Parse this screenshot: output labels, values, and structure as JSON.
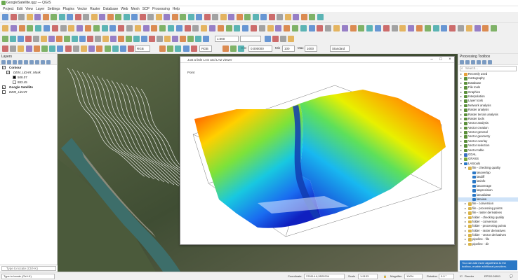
{
  "window": {
    "title": "GoogleSatellite.qgz — QGIS"
  },
  "menu": [
    "Project",
    "Edit",
    "View",
    "Layer",
    "Settings",
    "Plugins",
    "Vector",
    "Raster",
    "Database",
    "Web",
    "Mesh",
    "SCP",
    "Processing",
    "Help"
  ],
  "toolbar": {
    "scale_combo": "1:000",
    "rgb_combo": "RGB",
    "band_combo": "RGB",
    "dist_label": "Dist",
    "dist_value": "0.000000",
    "min_label": "Min",
    "min_value": "100",
    "max_label": "Max",
    "max_value": "1000",
    "standard_combo": "Standard"
  },
  "layers_panel": {
    "title": "Layers",
    "items": [
      {
        "label": "Contour",
        "checked": true,
        "bold": true,
        "indent": 0
      },
      {
        "label": "DEM_LiDAR_Mask",
        "checked": true,
        "bold": false,
        "indent": 1
      },
      {
        "label": "508.07",
        "swatch": "#000000",
        "indent": 2
      },
      {
        "label": "883.45",
        "swatch": "#ffffff",
        "indent": 2
      },
      {
        "label": "Google Satellite",
        "checked": true,
        "bold": true,
        "indent": 0
      },
      {
        "label": "DEM_LiDAR",
        "checked": false,
        "bold": false,
        "indent": 0
      }
    ],
    "search_placeholder": "Type to locate (Ctrl+K)"
  },
  "viewer": {
    "title": "Just a little LAS and LAZ viewer",
    "label": "Point"
  },
  "toolbox": {
    "title": "Processing Toolbox",
    "search_placeholder": "Search...",
    "items": [
      {
        "label": "Recently used",
        "level": 0,
        "arrow": "▸",
        "icon": "#e8a03a"
      },
      {
        "label": "Cartography",
        "level": 0,
        "arrow": "▸",
        "icon": "#5a8f3a"
      },
      {
        "label": "Database",
        "level": 0,
        "arrow": "▸",
        "icon": "#5a8f3a"
      },
      {
        "label": "File tools",
        "level": 0,
        "arrow": "▸",
        "icon": "#5a8f3a"
      },
      {
        "label": "Graphics",
        "level": 0,
        "arrow": "▸",
        "icon": "#5a8f3a"
      },
      {
        "label": "Interpolation",
        "level": 0,
        "arrow": "▸",
        "icon": "#5a8f3a"
      },
      {
        "label": "Layer tools",
        "level": 0,
        "arrow": "▸",
        "icon": "#5a8f3a"
      },
      {
        "label": "Network analysis",
        "level": 0,
        "arrow": "▸",
        "icon": "#5a8f3a"
      },
      {
        "label": "Raster analysis",
        "level": 0,
        "arrow": "▸",
        "icon": "#5a8f3a"
      },
      {
        "label": "Raster terrain analysis",
        "level": 0,
        "arrow": "▸",
        "icon": "#5a8f3a"
      },
      {
        "label": "Raster tools",
        "level": 0,
        "arrow": "▸",
        "icon": "#5a8f3a"
      },
      {
        "label": "Vector analysis",
        "level": 0,
        "arrow": "▸",
        "icon": "#5a8f3a"
      },
      {
        "label": "Vector creation",
        "level": 0,
        "arrow": "▸",
        "icon": "#5a8f3a"
      },
      {
        "label": "Vector general",
        "level": 0,
        "arrow": "▸",
        "icon": "#5a8f3a"
      },
      {
        "label": "Vector geometry",
        "level": 0,
        "arrow": "▸",
        "icon": "#5a8f3a"
      },
      {
        "label": "Vector overlay",
        "level": 0,
        "arrow": "▸",
        "icon": "#5a8f3a"
      },
      {
        "label": "Vector selection",
        "level": 0,
        "arrow": "▸",
        "icon": "#5a8f3a"
      },
      {
        "label": "Vector table",
        "level": 0,
        "arrow": "▸",
        "icon": "#5a8f3a"
      },
      {
        "label": "GDAL",
        "level": 0,
        "arrow": "▸",
        "icon": "#3a6fc2"
      },
      {
        "label": "GRASS",
        "level": 0,
        "arrow": "▸",
        "icon": "#7aa83a"
      },
      {
        "label": "LAStools",
        "level": 0,
        "arrow": "▾",
        "icon": "#2b78c6"
      },
      {
        "label": "file - checking quality",
        "level": 1,
        "arrow": "▾",
        "icon": "#d9b44a"
      },
      {
        "label": "lasoverlap",
        "level": 2,
        "arrow": "",
        "icon": "#2b78c6"
      },
      {
        "label": "lasdiff",
        "level": 2,
        "arrow": "",
        "icon": "#2b78c6"
      },
      {
        "label": "lasinfo",
        "level": 2,
        "arrow": "",
        "icon": "#2b78c6"
      },
      {
        "label": "lasoverage",
        "level": 2,
        "arrow": "",
        "icon": "#2b78c6"
      },
      {
        "label": "lasprecision",
        "level": 2,
        "arrow": "",
        "icon": "#2b78c6"
      },
      {
        "label": "lasvalidate",
        "level": 2,
        "arrow": "",
        "icon": "#2b78c6"
      },
      {
        "label": "lasview",
        "level": 2,
        "arrow": "",
        "icon": "#2b78c6",
        "selected": true
      },
      {
        "label": "file - conversion",
        "level": 1,
        "arrow": "▸",
        "icon": "#d9b44a"
      },
      {
        "label": "file - processing points",
        "level": 1,
        "arrow": "▸",
        "icon": "#d9b44a"
      },
      {
        "label": "file - raster derivatives",
        "level": 1,
        "arrow": "▸",
        "icon": "#d9b44a"
      },
      {
        "label": "folder - checking quality",
        "level": 1,
        "arrow": "▸",
        "icon": "#d9b44a"
      },
      {
        "label": "folder - conversion",
        "level": 1,
        "arrow": "▸",
        "icon": "#d9b44a"
      },
      {
        "label": "folder - processing points",
        "level": 1,
        "arrow": "▸",
        "icon": "#d9b44a"
      },
      {
        "label": "folder - raster derivatives",
        "level": 1,
        "arrow": "▸",
        "icon": "#d9b44a"
      },
      {
        "label": "folder - vector derivatives",
        "level": 1,
        "arrow": "▸",
        "icon": "#d9b44a"
      },
      {
        "label": "pipeline - file",
        "level": 1,
        "arrow": "▸",
        "icon": "#d9b44a"
      },
      {
        "label": "pipeline - dir",
        "level": 1,
        "arrow": "▸",
        "icon": "#d9b44a"
      }
    ],
    "notice": "You can add more algorithms to the toolbox, enable additional providers."
  },
  "statusbar": {
    "search_placeholder": "Type to locate (Ctrl+K)",
    "coordinate_label": "Coordinate",
    "coordinate_value": "376114.6,5520204",
    "scale_label": "Scale",
    "scale_value": "1:9133",
    "magnifier_label": "Magnifier",
    "magnifier_value": "100%",
    "rotation_label": "Rotation",
    "rotation_value": "0.0 °",
    "render_label": "Render",
    "crs_label": "EPSG:26911"
  }
}
